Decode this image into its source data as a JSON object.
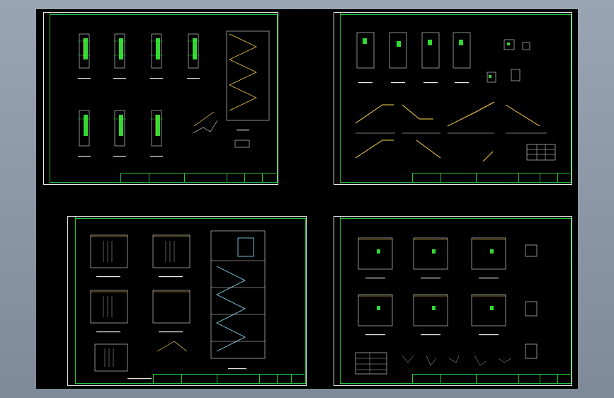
{
  "viewport": {
    "background": "#000000",
    "frame_color": "#23c23a",
    "line_color": "#e8e8e8",
    "accent_color": "#ffd84a",
    "text_green": "#3cff3c"
  },
  "sheets": [
    {
      "id": "sheet-1",
      "title_block_label": ""
    },
    {
      "id": "sheet-2",
      "title_block_label": ""
    },
    {
      "id": "sheet-3",
      "title_block_label": ""
    },
    {
      "id": "sheet-4",
      "title_block_label": ""
    }
  ]
}
